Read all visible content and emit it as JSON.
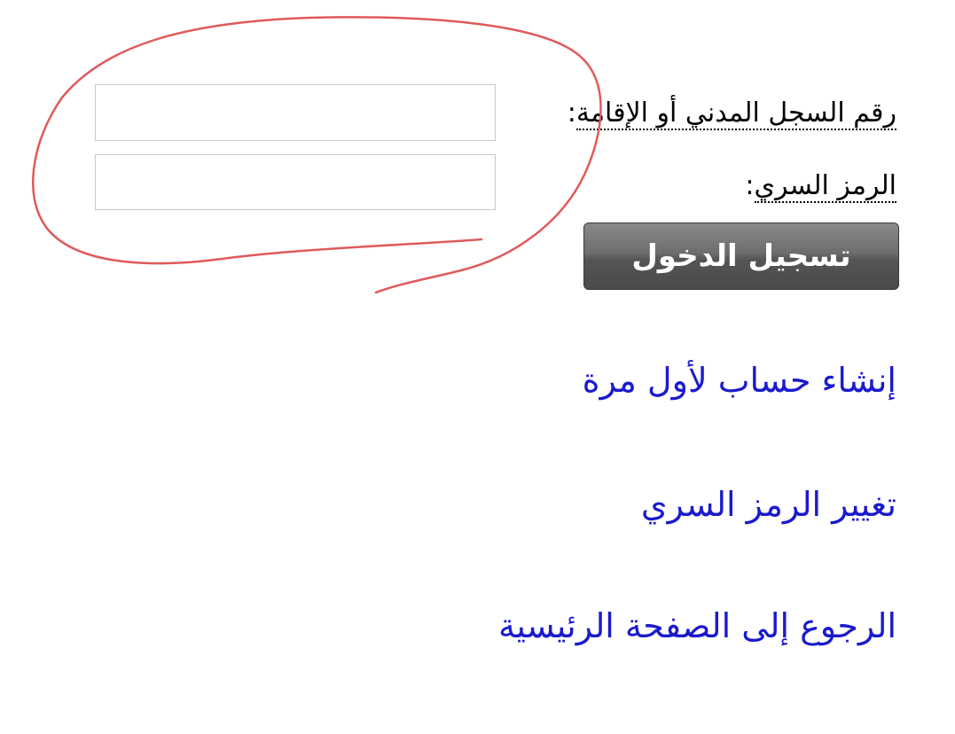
{
  "form": {
    "civil_id_label": "رقم السجل المدني أو الإقامة",
    "civil_id_colon": ":",
    "civil_id_value": "",
    "password_label": "الرمز السري",
    "password_colon": ":",
    "password_value": "",
    "login_button_label": "تسجيل الدخول"
  },
  "links": {
    "create_account": "إنشاء حساب لأول مرة",
    "change_password": "تغيير الرمز السري",
    "back_home": "الرجوع إلى الصفحة الرئيسية"
  },
  "colors": {
    "link": "#1a1acd",
    "annotation_stroke": "#e05a5a",
    "button": "#5a5a5a"
  }
}
